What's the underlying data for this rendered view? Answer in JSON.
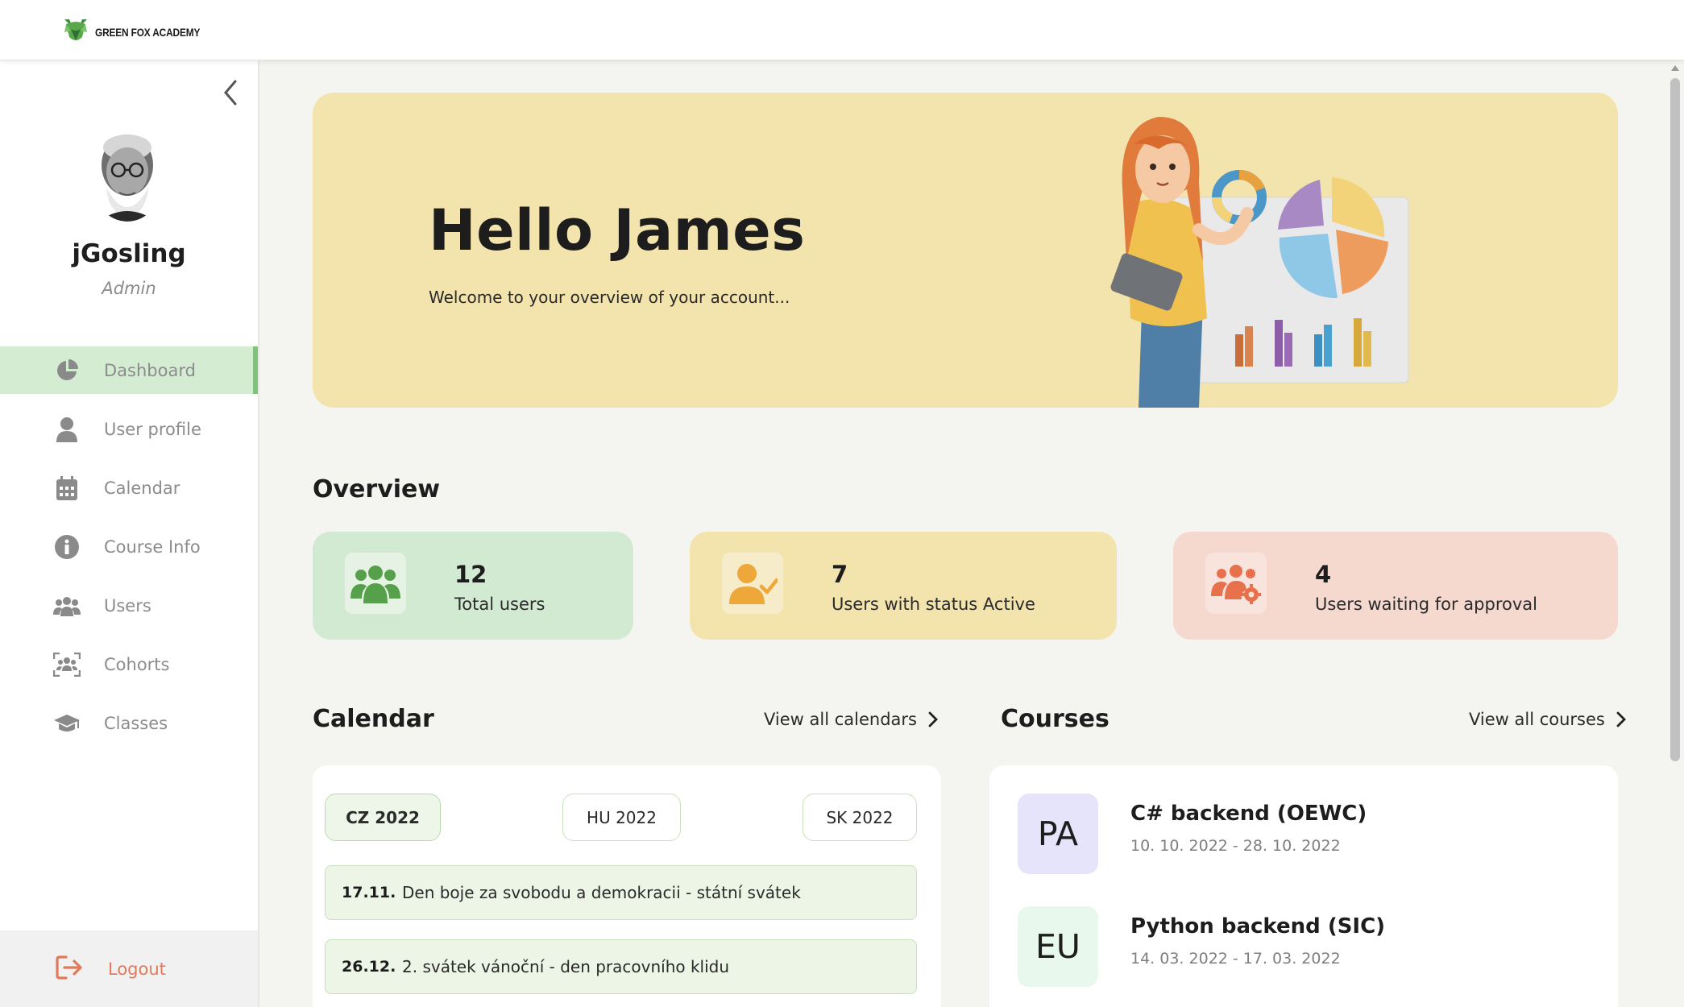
{
  "header": {
    "logo_text": "GREEN FOX ACADEMY"
  },
  "sidebar": {
    "user": {
      "name": "jGosling",
      "role": "Admin"
    },
    "items": [
      {
        "label": "Dashboard",
        "icon": "pie-chart-icon",
        "active": true
      },
      {
        "label": "User profile",
        "icon": "user-icon"
      },
      {
        "label": "Calendar",
        "icon": "calendar-icon"
      },
      {
        "label": "Course Info",
        "icon": "info-icon"
      },
      {
        "label": "Users",
        "icon": "users-icon"
      },
      {
        "label": "Cohorts",
        "icon": "cohorts-icon"
      },
      {
        "label": "Classes",
        "icon": "graduation-cap-icon"
      }
    ],
    "logout_label": "Logout"
  },
  "hero": {
    "title": "Hello James",
    "subtitle": "Welcome to your overview of your account..."
  },
  "overview": {
    "title": "Overview",
    "stats": [
      {
        "value": "12",
        "label": "Total users",
        "color": "#d3ead2",
        "icon": "users-group-icon"
      },
      {
        "value": "7",
        "label": "Users with status Active",
        "color": "#f3e4ad",
        "icon": "user-check-icon"
      },
      {
        "value": "4",
        "label": "Users waiting for approval",
        "color": "#f5d8ce",
        "icon": "users-gear-icon"
      }
    ]
  },
  "calendar": {
    "title": "Calendar",
    "view_all": "View all calendars",
    "tabs": [
      "CZ 2022",
      "HU 2022",
      "SK 2022"
    ],
    "active_tab": "CZ 2022",
    "holidays": [
      {
        "date": "17.11.",
        "name": "Den boje za svobodu a demokracii - státní svátek"
      },
      {
        "date": "26.12.",
        "name": "2. svátek vánoční - den pracovního klidu"
      }
    ]
  },
  "courses": {
    "title": "Courses",
    "view_all": "View all courses",
    "items": [
      {
        "badge": "PA",
        "badge_color": "#e6e4fb",
        "name": "C# backend (OEWC)",
        "dates": "10. 10. 2022 - 28. 10. 2022"
      },
      {
        "badge": "EU",
        "badge_color": "#e8f8ec",
        "name": "Python backend (SIC)",
        "dates": "14. 03. 2022 - 17. 03. 2022"
      }
    ]
  },
  "colors": {
    "accent_green": "#7ec27b",
    "hero_bg": "#f3e4ad",
    "logout": "#e07a5a"
  }
}
